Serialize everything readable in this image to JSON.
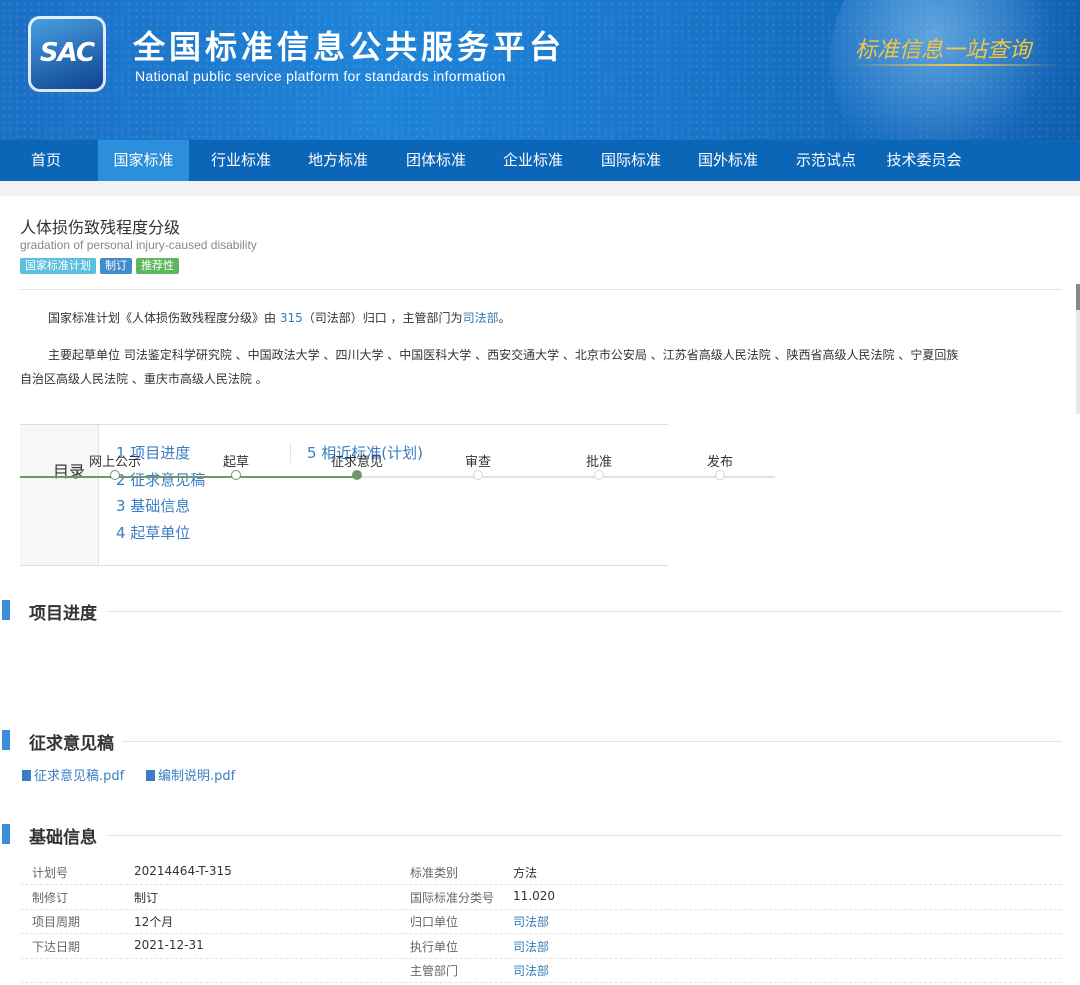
{
  "header": {
    "logo_text": "SAC",
    "title": "全国标准信息公共服务平台",
    "subtitle": "National public service platform  for standards information",
    "slogan": "标准信息一站查询"
  },
  "nav": [
    {
      "label": "首页"
    },
    {
      "label": "国家标准",
      "active": true
    },
    {
      "label": "行业标准"
    },
    {
      "label": "地方标准"
    },
    {
      "label": "团体标准"
    },
    {
      "label": "企业标准"
    },
    {
      "label": "国际标准"
    },
    {
      "label": "国外标准"
    },
    {
      "label": "示范试点"
    },
    {
      "label": "技术委员会"
    }
  ],
  "standard": {
    "title_cn": "人体损伤致残程度分级",
    "title_en": "gradation of personal injury-caused disability",
    "tags": [
      {
        "label": "国家标准计划",
        "color": "#5bc0de"
      },
      {
        "label": "制订",
        "color": "#428bca"
      },
      {
        "label": "推荐性",
        "color": "#5cb85c"
      }
    ],
    "intro": {
      "prefix": "国家标准计划《人体损伤致残程度分级》由 ",
      "tc_code": "315",
      "middle": "（司法部）归口 ，主管部门为",
      "dept": "司法部",
      "suffix": "。"
    },
    "drafters_line1": "主要起草单位 司法鉴定科学研究院 、中国政法大学 、四川大学 、中国医科大学 、西安交通大学 、北京市公安局 、江苏省高级人民法院 、陕西省高级人民法院 、宁夏回族",
    "drafters_line2": "自治区高级人民法院 、重庆市高级人民法院 。"
  },
  "toc": {
    "heading": "目录",
    "items": [
      "1  项目进度",
      "2  征求意见稿",
      "3  基础信息",
      "4  起草单位",
      "5  相近标准(计划)"
    ]
  },
  "progress": {
    "heading": "项目进度",
    "steps": [
      "网上公示",
      "起草",
      "征求意见",
      "审查",
      "批准",
      "发布"
    ],
    "current_step": 3
  },
  "drafts": {
    "heading": "征求意见稿",
    "files": [
      "征求意见稿.pdf",
      "编制说明.pdf"
    ]
  },
  "basic": {
    "heading": "基础信息",
    "left": [
      {
        "label": "计划号",
        "value": "20214464-T-315"
      },
      {
        "label": "制修订",
        "value": "制订"
      },
      {
        "label": "项目周期",
        "value": "12个月"
      },
      {
        "label": "下达日期",
        "value": "2021-12-31"
      }
    ],
    "right": [
      {
        "label": "标准类别",
        "value": "方法",
        "link": false
      },
      {
        "label": "国际标准分类号",
        "value": "11.020",
        "link": false
      },
      {
        "label": "归口单位",
        "value": "司法部",
        "link": true
      },
      {
        "label": "执行单位",
        "value": "司法部",
        "link": true
      },
      {
        "label": "主管部门",
        "value": "司法部",
        "link": true
      }
    ]
  }
}
